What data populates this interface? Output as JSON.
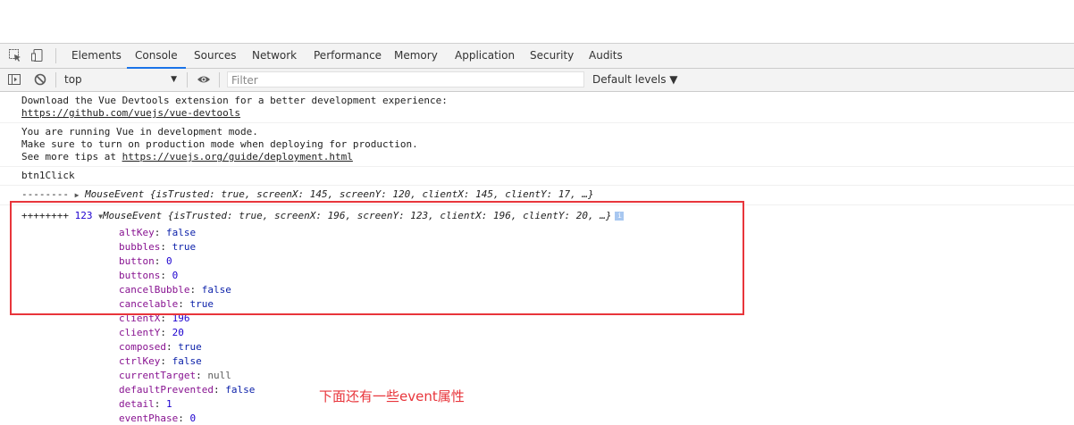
{
  "tabs": [
    "Elements",
    "Console",
    "Sources",
    "Network",
    "Performance",
    "Memory",
    "Application",
    "Security",
    "Audits"
  ],
  "active_tab": "Console",
  "toolbar": {
    "context": "top",
    "filter_placeholder": "Filter",
    "levels": "Default levels ▼"
  },
  "messages": {
    "vue_devtools_line1": "Download the Vue Devtools extension for a better development experience:",
    "vue_devtools_link": "https://github.com/vuejs/vue-devtools",
    "dev_mode_line1": "You are running Vue in development mode.",
    "dev_mode_line2": "Make sure to turn on production mode when deploying for production.",
    "dev_mode_line3_prefix": "See more tips at ",
    "dev_mode_link": "https://vuejs.org/guide/deployment.html",
    "btn_click": "btn1Click",
    "collapsed_prefix": "--------",
    "collapsed_obj": "MouseEvent {isTrusted: true, screenX: 145, screenY: 120, clientX: 145, clientY: 17, …}",
    "expanded_prefix": "++++++++",
    "expanded_num": "123",
    "expanded_obj": "MouseEvent {isTrusted: true, screenX: 196, screenY: 123, clientX: 196, clientY: 20, …}"
  },
  "properties": [
    {
      "key": "altKey",
      "value": "false",
      "kind": "bool"
    },
    {
      "key": "bubbles",
      "value": "true",
      "kind": "bool"
    },
    {
      "key": "button",
      "value": "0",
      "kind": "num"
    },
    {
      "key": "buttons",
      "value": "0",
      "kind": "num"
    },
    {
      "key": "cancelBubble",
      "value": "false",
      "kind": "bool"
    },
    {
      "key": "cancelable",
      "value": "true",
      "kind": "bool"
    },
    {
      "key": "clientX",
      "value": "196",
      "kind": "num"
    },
    {
      "key": "clientY",
      "value": "20",
      "kind": "num"
    },
    {
      "key": "composed",
      "value": "true",
      "kind": "bool"
    },
    {
      "key": "ctrlKey",
      "value": "false",
      "kind": "bool"
    },
    {
      "key": "currentTarget",
      "value": "null",
      "kind": "null"
    },
    {
      "key": "defaultPrevented",
      "value": "false",
      "kind": "bool"
    },
    {
      "key": "detail",
      "value": "1",
      "kind": "num"
    },
    {
      "key": "eventPhase",
      "value": "0",
      "kind": "num"
    }
  ],
  "annotation": "下面还有一些event属性",
  "colors": {
    "highlight": "#e8353b",
    "active_tab": "#1a73e8"
  }
}
